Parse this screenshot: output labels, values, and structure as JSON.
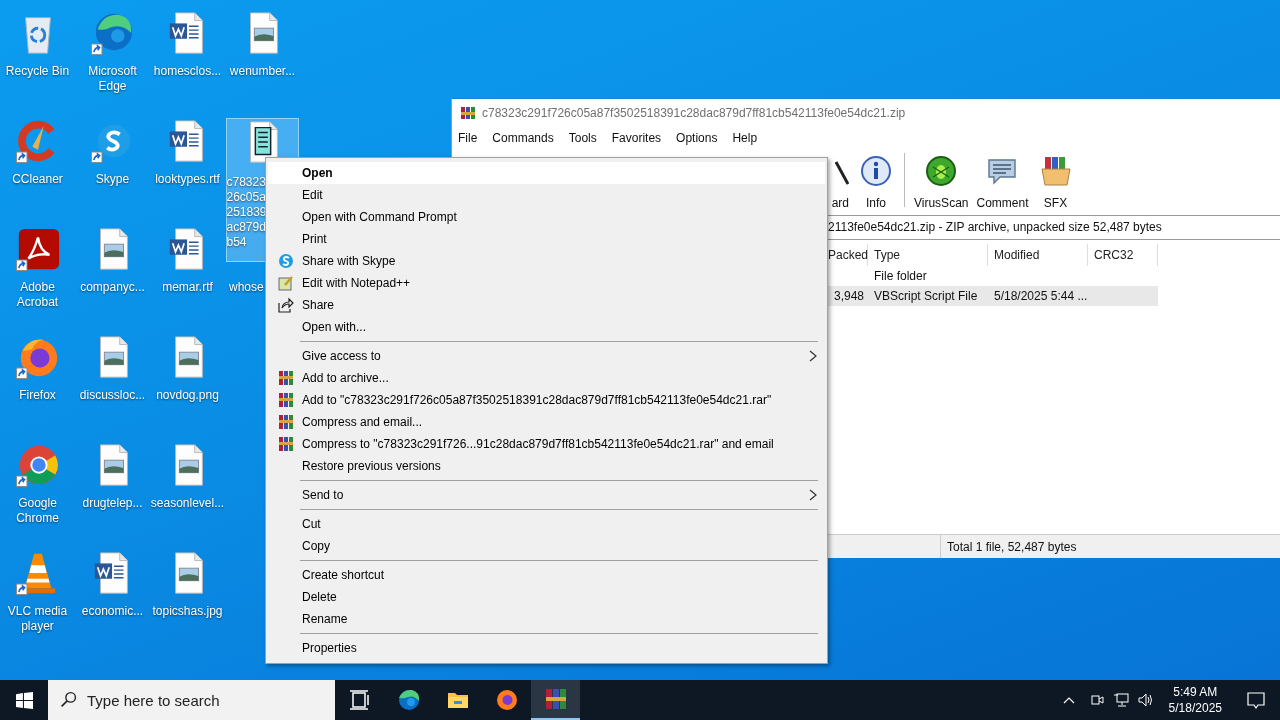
{
  "desktop_icons": [
    {
      "label": "Recycle Bin",
      "kind": "recycle",
      "shortcut": false,
      "selected": false
    },
    {
      "label": "CCleaner",
      "kind": "ccleaner",
      "shortcut": true,
      "selected": false
    },
    {
      "label": "Adobe Acrobat",
      "kind": "acrobat",
      "shortcut": true,
      "selected": false
    },
    {
      "label": "Firefox",
      "kind": "firefox",
      "shortcut": true,
      "selected": false
    },
    {
      "label": "Google Chrome",
      "kind": "chrome",
      "shortcut": true,
      "selected": false
    },
    {
      "label": "VLC media player",
      "kind": "vlc",
      "shortcut": true,
      "selected": false
    },
    {
      "label": "Microsoft Edge",
      "kind": "edge",
      "shortcut": true,
      "selected": false
    },
    {
      "label": "Skype",
      "kind": "skype",
      "shortcut": true,
      "selected": false
    },
    {
      "label": "companyc...",
      "kind": "image",
      "shortcut": false,
      "selected": false
    },
    {
      "label": "discussloc...",
      "kind": "image",
      "shortcut": false,
      "selected": false
    },
    {
      "label": "drugtelep...",
      "kind": "image",
      "shortcut": false,
      "selected": false
    },
    {
      "label": "economic...",
      "kind": "word",
      "shortcut": false,
      "selected": false
    },
    {
      "label": "homesclos...",
      "kind": "word",
      "shortcut": false,
      "selected": false
    },
    {
      "label": "looktypes.rtf",
      "kind": "word",
      "shortcut": false,
      "selected": false
    },
    {
      "label": "memar.rtf",
      "kind": "word",
      "shortcut": false,
      "selected": false
    },
    {
      "label": "novdog.png",
      "kind": "image",
      "shortcut": false,
      "selected": false
    },
    {
      "label": "seasonlevel...",
      "kind": "image",
      "shortcut": false,
      "selected": false
    },
    {
      "label": "topicshas.jpg",
      "kind": "image",
      "shortcut": false,
      "selected": false
    },
    {
      "label": "wenumber...",
      "kind": "image",
      "shortcut": false,
      "selected": false
    },
    {
      "label_lines": [
        "c78323",
        "26c05a",
        "251839",
        "ac879d",
        "b54"
      ],
      "kind": "script",
      "shortcut": false,
      "selected": true
    },
    {
      "label": "whose",
      "kind": "hidden",
      "selected": false
    }
  ],
  "archiver_window": {
    "title": "c78323c291f726c05a87f3502518391c28dac879d7ff81cb542113fe0e54dc21.zip",
    "menu": [
      "File",
      "Commands",
      "Tools",
      "Favorites",
      "Options",
      "Help"
    ],
    "toolbar": [
      {
        "label": "ard",
        "kind": "wand"
      },
      {
        "label": "Info",
        "kind": "info"
      },
      {
        "label": "VirusScan",
        "kind": "bug"
      },
      {
        "label": "Comment",
        "kind": "comment"
      },
      {
        "label": "SFX",
        "kind": "box"
      }
    ],
    "address": "2113fe0e54dc21.zip - ZIP archive, unpacked size 52,487 bytes",
    "columns": [
      "Packed",
      "Type",
      "Modified",
      "CRC32"
    ],
    "rows": [
      {
        "type": "File folder",
        "selected": false
      },
      {
        "packed": "3,948",
        "type": "VBScript Script File",
        "modified": "5/18/2025 5:44 ...",
        "selected": true
      }
    ],
    "status": "Total 1 file, 52,487 bytes"
  },
  "context_menu": [
    {
      "kind": "item",
      "label": "Open",
      "bold": true,
      "selected": true
    },
    {
      "kind": "item",
      "label": "Edit",
      "bold": false,
      "selected": false
    },
    {
      "kind": "item",
      "label": "Open with Command Prompt",
      "bold": false,
      "selected": false
    },
    {
      "kind": "item",
      "label": "Print",
      "bold": false,
      "selected": false
    },
    {
      "kind": "skype",
      "label": "Share with Skype",
      "bold": false,
      "selected": false
    },
    {
      "kind": "notepad",
      "label": "Edit with Notepad++",
      "bold": false,
      "selected": false
    },
    {
      "kind": "share",
      "label": "Share",
      "bold": false,
      "selected": false
    },
    {
      "kind": "item",
      "label": "Open with...",
      "bold": false,
      "selected": false
    },
    {
      "kind": "separator"
    },
    {
      "kind": "item",
      "label": "Give access to",
      "submenu": true,
      "bold": false,
      "selected": false
    },
    {
      "kind": "archive",
      "label": "Add to archive...",
      "bold": false,
      "selected": false
    },
    {
      "kind": "archive",
      "label": "Add to \"c78323c291f726c05a87f3502518391c28dac879d7ff81cb542113fe0e54dc21.rar\"",
      "bold": false,
      "selected": false
    },
    {
      "kind": "archive",
      "label": "Compress and email...",
      "bold": false,
      "selected": false
    },
    {
      "kind": "archive",
      "label": "Compress to \"c78323c291f726...91c28dac879d7ff81cb542113fe0e54dc21.rar\" and email",
      "bold": false,
      "selected": false
    },
    {
      "kind": "item",
      "label": "Restore previous versions",
      "bold": false,
      "selected": false
    },
    {
      "kind": "separator"
    },
    {
      "kind": "item",
      "label": "Send to",
      "submenu": true,
      "bold": false,
      "selected": false
    },
    {
      "kind": "separator"
    },
    {
      "kind": "item",
      "label": "Cut",
      "bold": false,
      "selected": false
    },
    {
      "kind": "item",
      "label": "Copy",
      "bold": false,
      "selected": false
    },
    {
      "kind": "separator"
    },
    {
      "kind": "item",
      "label": "Create shortcut",
      "bold": false,
      "selected": false
    },
    {
      "kind": "item",
      "label": "Delete",
      "bold": false,
      "selected": false
    },
    {
      "kind": "item",
      "label": "Rename",
      "bold": false,
      "selected": false
    },
    {
      "kind": "separator"
    },
    {
      "kind": "item",
      "label": "Properties",
      "bold": false,
      "selected": false
    }
  ],
  "taskbar": {
    "search": {
      "placeholder": "Type here to search"
    },
    "apps": [
      {
        "kind": "taskview",
        "active": false
      },
      {
        "kind": "edge",
        "active": false
      },
      {
        "kind": "explorer",
        "active": false
      },
      {
        "kind": "firefox",
        "active": false
      },
      {
        "kind": "winrar",
        "active": true
      }
    ],
    "time": "5:49 AM",
    "date": "5/18/2025"
  }
}
